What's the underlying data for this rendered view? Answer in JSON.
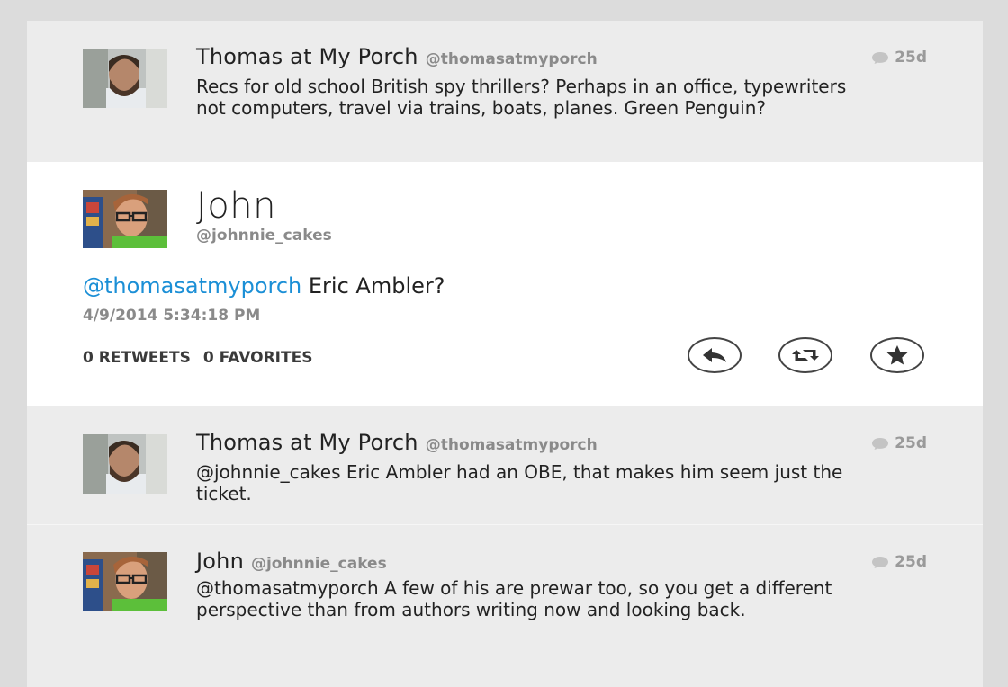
{
  "tweets_top": [
    {
      "display_name": "Thomas at My Porch",
      "handle": "@thomasatmyporch",
      "age": "25d",
      "text": "Recs for old school British spy thrillers? Perhaps in an office, typewriters not computers, travel via trains, boats, planes. Green Penguin?"
    }
  ],
  "main_tweet": {
    "display_name": "John",
    "handle": "@johnnie_cakes",
    "mention": "@thomasatmyporch",
    "text": " Eric Ambler?",
    "timestamp": "4/9/2014 5:34:18 PM",
    "retweets_label": "0 RETWEETS",
    "favorites_label": "0 FAVORITES",
    "actions": [
      "reply-icon",
      "retweet-icon",
      "favorite-icon"
    ]
  },
  "tweets_bottom": [
    {
      "display_name": "Thomas at My Porch",
      "handle": "@thomasatmyporch",
      "age": "25d",
      "text": "@johnnie_cakes Eric Ambler had an OBE, that makes him seem just the ticket."
    },
    {
      "display_name": "John",
      "handle": "@johnnie_cakes",
      "age": "25d",
      "text": "@thomasatmyporch A few of his are prewar too, so you get a different perspective than from authors writing now and looking back."
    }
  ],
  "colors": {
    "mention": "#1b8fd6",
    "background": "#ececec",
    "selected": "#ffffff"
  }
}
